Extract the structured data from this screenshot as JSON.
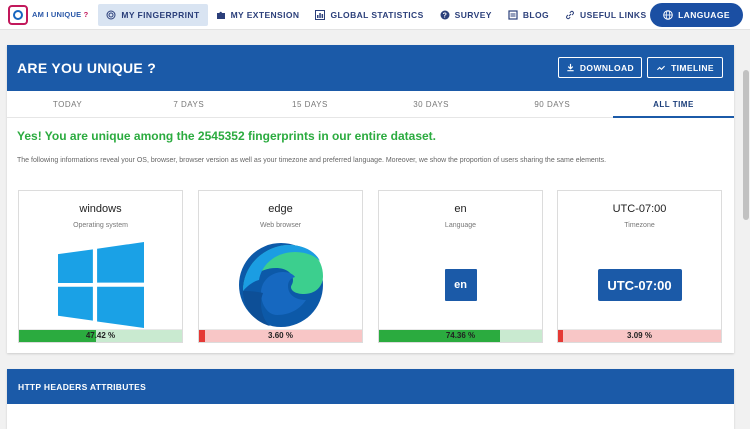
{
  "nav": {
    "logo_text": "AM I UNIQUE",
    "logo_q": "?",
    "items": [
      {
        "label": "MY FINGERPRINT",
        "icon": "fingerprint-icon"
      },
      {
        "label": "MY EXTENSION",
        "icon": "puzzle-icon"
      },
      {
        "label": "GLOBAL STATISTICS",
        "icon": "chart-icon"
      },
      {
        "label": "SURVEY",
        "icon": "help-icon"
      },
      {
        "label": "BLOG",
        "icon": "blog-icon"
      },
      {
        "label": "USEFUL LINKS",
        "icon": "link-icon"
      }
    ],
    "language_label": "LANGUAGE"
  },
  "main": {
    "title": "ARE YOU UNIQUE ?",
    "download_label": "DOWNLOAD",
    "timeline_label": "TIMELINE",
    "tabs": [
      "TODAY",
      "7 DAYS",
      "15 DAYS",
      "30 DAYS",
      "90 DAYS",
      "ALL TIME"
    ],
    "active_tab": "ALL TIME",
    "unique_message": "Yes! You are unique among the 2545352 fingerprints in our entire dataset.",
    "description": "The following informations reveal your OS, browser, browser version as well as your timezone and preferred language. Moreover, we show the proportion of users sharing the same elements.",
    "attributes": [
      {
        "value": "windows",
        "label": "Operating system",
        "percent_text": "47.42 %",
        "fraction": 0.4742,
        "status": "good"
      },
      {
        "value": "edge",
        "label": "Web browser",
        "percent_text": "3.60 %",
        "fraction": 0.036,
        "status": "bad"
      },
      {
        "value": "en",
        "label": "Language",
        "percent_text": "74.36 %",
        "fraction": 0.7436,
        "status": "good",
        "badge": "en"
      },
      {
        "value": "UTC-07:00",
        "label": "Timezone",
        "percent_text": "3.09 %",
        "fraction": 0.0309,
        "status": "bad",
        "badge": "UTC-07:00"
      }
    ]
  },
  "http": {
    "title": "HTTP HEADERS ATTRIBUTES"
  },
  "colors": {
    "brand": "#1b5aa8",
    "success": "#2bab3f",
    "danger": "#e53935"
  }
}
